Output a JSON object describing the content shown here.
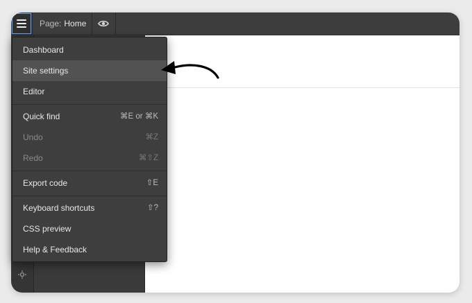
{
  "topbar": {
    "page_prefix": "Page:",
    "page_name": "Home",
    "menu_icon": "hamburger-icon",
    "preview_icon": "eye-icon"
  },
  "menu": {
    "items": [
      {
        "label": "Dashboard",
        "shortcut": ""
      },
      {
        "label": "Site settings",
        "shortcut": ""
      },
      {
        "label": "Editor",
        "shortcut": ""
      },
      {
        "label": "Quick find",
        "shortcut": "⌘E or ⌘K"
      },
      {
        "label": "Undo",
        "shortcut": "⌘Z"
      },
      {
        "label": "Redo",
        "shortcut": "⌘⇧Z"
      },
      {
        "label": "Export code",
        "shortcut": "⇧E"
      },
      {
        "label": "Keyboard shortcuts",
        "shortcut": "⇧?"
      },
      {
        "label": "CSS preview",
        "shortcut": ""
      },
      {
        "label": "Help & Feedback",
        "shortcut": ""
      }
    ]
  },
  "colors": {
    "chrome": "#3d3d3d",
    "menu_bg": "#3e3e3e",
    "highlight": "#525252",
    "focus_ring": "#5aa7ff",
    "arrow": "#000000"
  }
}
